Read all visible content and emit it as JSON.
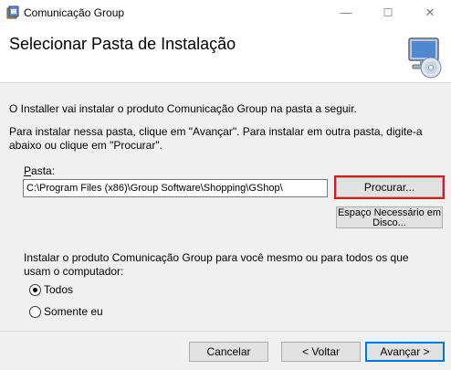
{
  "window": {
    "title": "Comunicação Group",
    "minimize_glyph": "—",
    "maximize_glyph": "☐",
    "close_glyph": "✕"
  },
  "header": {
    "title": "Selecionar Pasta de Instalação",
    "icon": "computer-cd-icon"
  },
  "body": {
    "intro": "O Installer vai instalar o produto Comunicação Group na pasta a seguir.",
    "instructions": "Para instalar nessa pasta, clique em \"Avançar\". Para instalar em outra pasta, digite-a abaixo ou clique em \"Procurar\"."
  },
  "folder": {
    "label_first": "P",
    "label_rest": "asta:",
    "value": "C:\\Program Files (x86)\\Group Software\\Shopping\\GShop\\",
    "browse_label": "Procurar...",
    "disk_cost_line1": "Espaço Necessário em",
    "disk_cost_line2": "Disco..."
  },
  "install_for": {
    "prompt": "Instalar o produto Comunicação Group para você mesmo ou para todos os que usam o computador:",
    "options": [
      {
        "label": "Todos",
        "checked": true
      },
      {
        "label": "Somente eu",
        "checked": false
      }
    ]
  },
  "footer": {
    "cancel": "Cancelar",
    "back": "< Voltar",
    "next": "Avançar >"
  },
  "colors": {
    "highlight": "#e81123",
    "default_button": "#0078d7"
  }
}
